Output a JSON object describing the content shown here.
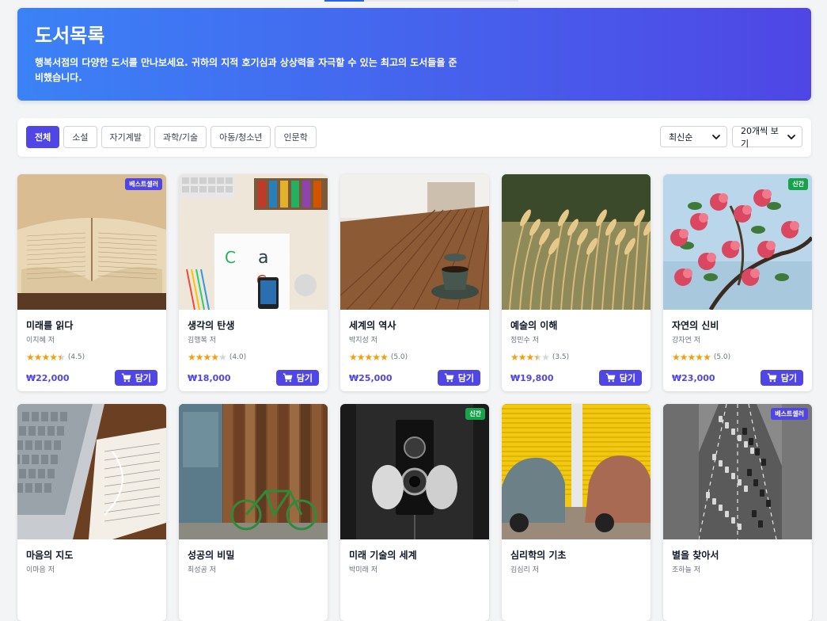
{
  "hero": {
    "title": "도서목록",
    "description": "행복서점의 다양한 도서를 만나보세요. 귀하의 지적 호기심과 상상력을 자극할 수 있는 최고의 도서들을 준비했습니다."
  },
  "filters": {
    "categories": [
      "전체",
      "소설",
      "자기계발",
      "과학/기술",
      "아동/청소년",
      "인문학"
    ],
    "active_index": 0,
    "sort_value": "최신순",
    "page_size_value": "20개씩 보기"
  },
  "cart_label": "담기",
  "books": [
    {
      "title": "미래를 읽다",
      "author": "이지혜 저",
      "rating": 4.5,
      "rating_text": "(4.5)",
      "price": "₩22,000",
      "badge": "베스트셀러",
      "badge_type": "best",
      "image": "open-book"
    },
    {
      "title": "생각의 탄생",
      "author": "김행복 저",
      "rating": 4.0,
      "rating_text": "(4.0)",
      "price": "₩18,000",
      "badge": "",
      "badge_type": "",
      "image": "desk-design"
    },
    {
      "title": "세계의 역사",
      "author": "박지성 저",
      "rating": 5.0,
      "rating_text": "(5.0)",
      "price": "₩25,000",
      "badge": "",
      "badge_type": "",
      "image": "cafe-table"
    },
    {
      "title": "예술의 이해",
      "author": "정민수 저",
      "rating": 3.5,
      "rating_text": "(3.5)",
      "price": "₩19,800",
      "badge": "",
      "badge_type": "",
      "image": "wheat-field"
    },
    {
      "title": "자연의 신비",
      "author": "강자연 저",
      "rating": 5.0,
      "rating_text": "(5.0)",
      "price": "₩23,000",
      "badge": "신간",
      "badge_type": "new",
      "image": "pink-flowers"
    },
    {
      "title": "마음의 지도",
      "author": "이마음 저",
      "rating": 0,
      "rating_text": "",
      "price": "",
      "badge": "",
      "badge_type": "",
      "image": "laptop-notebook"
    },
    {
      "title": "성공의 비밀",
      "author": "최성공 저",
      "rating": 0,
      "rating_text": "",
      "price": "",
      "badge": "",
      "badge_type": "",
      "image": "bicycle-wall"
    },
    {
      "title": "미래 기술의 세계",
      "author": "박미래 저",
      "rating": 0,
      "rating_text": "",
      "price": "",
      "badge": "신간",
      "badge_type": "new",
      "image": "vintage-camera"
    },
    {
      "title": "심리학의 기초",
      "author": "김심리 저",
      "rating": 0,
      "rating_text": "",
      "price": "",
      "badge": "",
      "badge_type": "",
      "image": "vintage-cars"
    },
    {
      "title": "별을 찾아서",
      "author": "조하늘 저",
      "rating": 0,
      "rating_text": "",
      "price": "",
      "badge": "베스트셀러",
      "badge_type": "best",
      "image": "city-traffic"
    }
  ],
  "colors": {
    "accent": "#4f46e5",
    "hero_start": "#3b82f6",
    "hero_end": "#4f46e5",
    "star": "#f59e0b",
    "new_badge": "#16a34a"
  }
}
